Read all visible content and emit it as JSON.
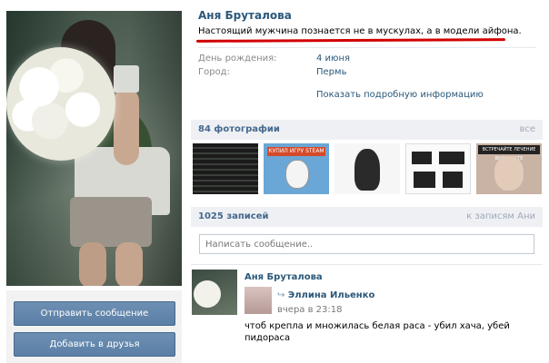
{
  "profile": {
    "name": "Аня Бруталова",
    "status": "Настоящий мужчина познается не в мускулах, а в модели айфона.",
    "info": [
      {
        "label": "День рождения:",
        "value": "4 июня"
      },
      {
        "label": "Город:",
        "value": "Пермь"
      }
    ],
    "more_info": "Показать подробную информацию"
  },
  "actions": {
    "send_message": "Отправить сообщение",
    "add_friend": "Добавить в друзья"
  },
  "photos": {
    "title": "84 фотографии",
    "all_link": "все",
    "thumbs": [
      {
        "label": ""
      },
      {
        "label": "КУПИЛ ИГРУ STEAM"
      },
      {
        "label": ""
      },
      {
        "label": ""
      },
      {
        "label": "ВСТРЕЧАЙТЕ ЛЕЧЕНИЕ ВКОНТАКТЕ"
      }
    ]
  },
  "wall": {
    "title": "1025 записей",
    "to_posts_link": "к записям Ани",
    "input_placeholder": "Написать сообщение..",
    "post": {
      "author": "Аня Бруталова",
      "repost_arrow": "↪",
      "repost_author": "Эллина Ильенко",
      "time": "вчера в 23:18",
      "text": "чтоб крепла и множилась белая раса - убил хача, убей пидораса"
    }
  },
  "colors": {
    "link": "#2b587a",
    "button": "#5b7fa6",
    "highlight_underline": "#d10000",
    "section_bg": "#eef0f3"
  }
}
